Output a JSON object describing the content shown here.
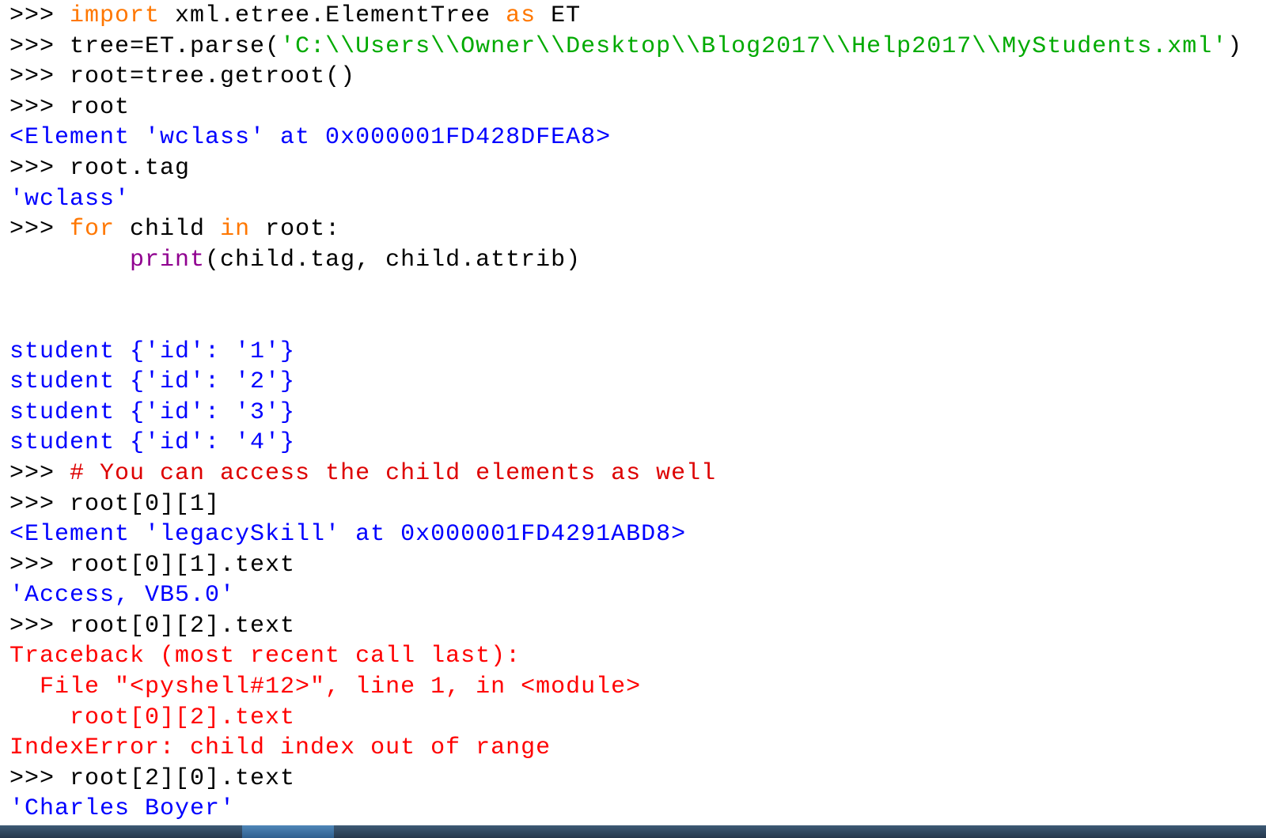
{
  "colors": {
    "prompt": "#000000",
    "plain": "#000000",
    "keyword": "#ff7700",
    "string": "#00aa00",
    "builtin": "#900090",
    "comment": "#dd0000",
    "output": "#0000ff",
    "error": "#ff0000",
    "taskbar": "#2e4660",
    "taskbar_active": "#3f73a6"
  },
  "lines": [
    [
      {
        "t": ">>> ",
        "c": "prompt"
      },
      {
        "t": "import",
        "c": "kw"
      },
      {
        "t": " xml.etree.ElementTree ",
        "c": "plain"
      },
      {
        "t": "as",
        "c": "kw"
      },
      {
        "t": " ET",
        "c": "plain"
      }
    ],
    [
      {
        "t": ">>> ",
        "c": "prompt"
      },
      {
        "t": "tree=ET.parse(",
        "c": "plain"
      },
      {
        "t": "'C:\\\\Users\\\\Owner\\\\Desktop\\\\Blog2017\\\\Help2017\\\\MyStudents.xml'",
        "c": "str"
      },
      {
        "t": ")",
        "c": "plain"
      }
    ],
    [
      {
        "t": ">>> ",
        "c": "prompt"
      },
      {
        "t": "root=tree.getroot()",
        "c": "plain"
      }
    ],
    [
      {
        "t": ">>> ",
        "c": "prompt"
      },
      {
        "t": "root",
        "c": "plain"
      }
    ],
    [
      {
        "t": "<Element 'wclass' at 0x000001FD428DFEA8>",
        "c": "out"
      }
    ],
    [
      {
        "t": ">>> ",
        "c": "prompt"
      },
      {
        "t": "root.tag",
        "c": "plain"
      }
    ],
    [
      {
        "t": "'wclass'",
        "c": "out"
      }
    ],
    [
      {
        "t": ">>> ",
        "c": "prompt"
      },
      {
        "t": "for",
        "c": "kw"
      },
      {
        "t": " child ",
        "c": "plain"
      },
      {
        "t": "in",
        "c": "kw"
      },
      {
        "t": " root:",
        "c": "plain"
      }
    ],
    [
      {
        "t": "        ",
        "c": "plain"
      },
      {
        "t": "print",
        "c": "builtin"
      },
      {
        "t": "(child.tag, child.attrib)",
        "c": "plain"
      }
    ],
    [],
    [],
    [
      {
        "t": "student {'id': '1'}",
        "c": "out"
      }
    ],
    [
      {
        "t": "student {'id': '2'}",
        "c": "out"
      }
    ],
    [
      {
        "t": "student {'id': '3'}",
        "c": "out"
      }
    ],
    [
      {
        "t": "student {'id': '4'}",
        "c": "out"
      }
    ],
    [
      {
        "t": ">>> ",
        "c": "prompt"
      },
      {
        "t": "# You can access the child elements as well",
        "c": "comment"
      }
    ],
    [
      {
        "t": ">>> ",
        "c": "prompt"
      },
      {
        "t": "root[0][1]",
        "c": "plain"
      }
    ],
    [
      {
        "t": "<Element 'legacySkill' at 0x000001FD4291ABD8>",
        "c": "out"
      }
    ],
    [
      {
        "t": ">>> ",
        "c": "prompt"
      },
      {
        "t": "root[0][1].text",
        "c": "plain"
      }
    ],
    [
      {
        "t": "'Access, VB5.0'",
        "c": "out"
      }
    ],
    [
      {
        "t": ">>> ",
        "c": "prompt"
      },
      {
        "t": "root[0][2].text",
        "c": "plain"
      }
    ],
    [
      {
        "t": "Traceback (most recent call last):",
        "c": "err"
      }
    ],
    [
      {
        "t": "  File \"<pyshell#12>\", line 1, in <module>",
        "c": "err"
      }
    ],
    [
      {
        "t": "    root[0][2].text",
        "c": "err"
      }
    ],
    [
      {
        "t": "IndexError: child index out of range",
        "c": "err"
      }
    ],
    [
      {
        "t": ">>> ",
        "c": "prompt"
      },
      {
        "t": "root[2][0].text",
        "c": "plain"
      }
    ],
    [
      {
        "t": "'Charles Boyer'",
        "c": "out"
      }
    ]
  ]
}
